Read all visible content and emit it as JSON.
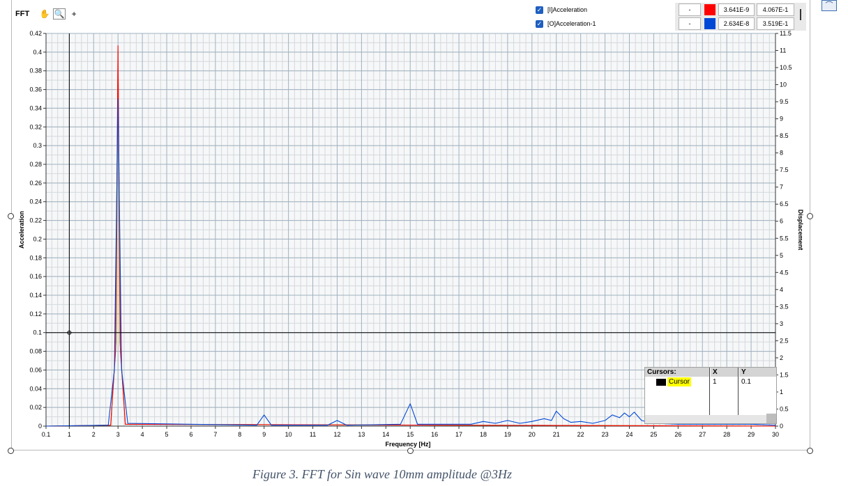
{
  "toolbar": {
    "title": "FFT",
    "pan_icon": "hand-pan-icon",
    "zoom_icon": "zoom-icon",
    "crosshair_icon": "crosshair-icon"
  },
  "legend": {
    "items": [
      {
        "checked": true,
        "label": "[I]Acceleration",
        "dash": "-",
        "color": "#ff0000",
        "v1": "3.641E-9",
        "v2": "4.067E-1"
      },
      {
        "checked": true,
        "label": "[O]Acceleration-1",
        "dash": "-",
        "color": "#0047d6",
        "v1": "2.634E-8",
        "v2": "3.519E-1"
      }
    ]
  },
  "cursors": {
    "header": {
      "name": "Cursors:",
      "x": "X",
      "y": "Y"
    },
    "rows": [
      {
        "name": "Cursor",
        "x": "1",
        "y": "0.1",
        "color": "#000000"
      }
    ]
  },
  "caption": "Figure 3. FFT for Sin wave 10mm amplitude @3Hz",
  "chart_data": {
    "type": "line",
    "xlabel": "Frequency [Hz]",
    "ylabel": "Acceleration",
    "y2label": "Displacement",
    "xlim": [
      0.1,
      30
    ],
    "ylim": [
      0,
      0.42
    ],
    "y2lim": [
      0,
      11.5
    ],
    "grid": true,
    "x_ticks": [
      "0.1",
      "1",
      "2",
      "3",
      "4",
      "5",
      "6",
      "7",
      "8",
      "9",
      "10",
      "11",
      "12",
      "13",
      "14",
      "15",
      "16",
      "17",
      "18",
      "19",
      "20",
      "21",
      "22",
      "23",
      "24",
      "25",
      "26",
      "27",
      "28",
      "29",
      "30"
    ],
    "y_ticks": [
      "0",
      "0.02",
      "0.04",
      "0.06",
      "0.08",
      "0.1",
      "0.12",
      "0.14",
      "0.16",
      "0.18",
      "0.2",
      "0.22",
      "0.24",
      "0.26",
      "0.28",
      "0.3",
      "0.32",
      "0.34",
      "0.36",
      "0.38",
      "0.4",
      "0.42"
    ],
    "y2_ticks": [
      "0",
      "0.5",
      "1",
      "1.5",
      "2",
      "2.5",
      "3",
      "3.5",
      "4",
      "4.5",
      "5",
      "5.5",
      "6",
      "6.5",
      "7",
      "7.5",
      "8",
      "8.5",
      "9",
      "9.5",
      "10",
      "10.5",
      "11",
      "11.5"
    ],
    "cursor": {
      "x": 1,
      "y": 0.1
    },
    "series": [
      {
        "name": "[O]Acceleration-1",
        "color": "#0047d6",
        "x": [
          0.1,
          2.6,
          2.85,
          3.0,
          3.15,
          3.4,
          8.7,
          9.0,
          9.3,
          11.6,
          12.0,
          12.4,
          14.6,
          15.0,
          15.3,
          16.0,
          17.5,
          18.0,
          18.5,
          19.0,
          19.5,
          20.0,
          20.5,
          20.8,
          21.0,
          21.3,
          21.6,
          22.0,
          22.5,
          23.0,
          23.3,
          23.6,
          23.8,
          24.0,
          24.2,
          24.5,
          25,
          26,
          27,
          28,
          29,
          30
        ],
        "y": [
          0,
          0.001,
          0.06,
          0.35,
          0.06,
          0.003,
          0.001,
          0.012,
          0.001,
          0.001,
          0.006,
          0.001,
          0.002,
          0.024,
          0.002,
          0.002,
          0.002,
          0.005,
          0.003,
          0.006,
          0.003,
          0.005,
          0.008,
          0.006,
          0.016,
          0.008,
          0.004,
          0.005,
          0.003,
          0.006,
          0.012,
          0.009,
          0.014,
          0.01,
          0.015,
          0.006,
          0.003,
          0.002,
          0.002,
          0.002,
          0.002,
          0.001
        ]
      },
      {
        "name": "[I]Acceleration",
        "color": "#ff0000",
        "x": [
          0.1,
          2.7,
          2.9,
          3.0,
          3.1,
          3.3,
          30
        ],
        "y": [
          0,
          0.001,
          0.08,
          0.407,
          0.08,
          0.002,
          0
        ]
      },
      {
        "color": "#7a8a00",
        "x": [
          0.1,
          2.7,
          2.92,
          3.0,
          3.08,
          3.3,
          30
        ],
        "y": [
          0,
          0.001,
          0.09,
          0.4,
          0.09,
          0.002,
          0
        ]
      }
    ]
  }
}
